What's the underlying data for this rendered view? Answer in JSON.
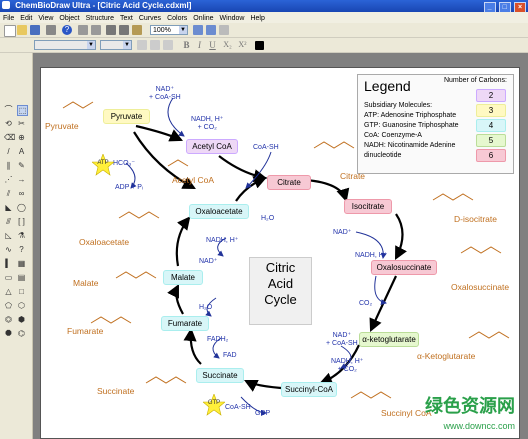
{
  "window": {
    "title": "ChemBioDraw Ultra - [Citric Acid Cycle.cdxml]",
    "controls": [
      "_",
      "□",
      "×"
    ]
  },
  "menu": [
    "File",
    "Edit",
    "View",
    "Object",
    "Structure",
    "Text",
    "Curves",
    "Colors",
    "Online",
    "Window",
    "Help"
  ],
  "toolbar": {
    "zoom": "100%",
    "format_buttons": [
      "B",
      "I",
      "U",
      "X₂",
      "X²"
    ]
  },
  "legend": {
    "title": "Legend",
    "carbons_label": "Number of Carbons:",
    "subsidiary_title": "Subsidiary Molecules:",
    "entries": [
      "ATP: Adenosine Triphosphate",
      "GTP: Guanosine Triphosphate",
      "CoA: Coenzyme-A",
      "NADH: Nicotinamide Adenine",
      "dinucleotide"
    ],
    "carbons": [
      "2",
      "3",
      "4",
      "5",
      "6"
    ]
  },
  "center": {
    "line1": "Citric",
    "line2": "Acid",
    "line3": "Cycle"
  },
  "boxes": {
    "pyruvate": "Pyruvate",
    "acetyl_coa": "Acetyl CoA",
    "citrate": "Citrate",
    "isocitrate": "Isocitrate",
    "oxalosuccinate": "Oxalosuccinate",
    "ketoglutarate": "α-ketoglutarate",
    "succinyl_coa": "Succinyl-CoA",
    "succinate": "Succinate",
    "fumarate": "Fumarate",
    "malate": "Malate",
    "oxaloacetate": "Oxaloacetate"
  },
  "molecule_names": {
    "pyruvate": "Pyruvate",
    "acetyl_coa": "Acetyl CoA",
    "citrate": "Citrate",
    "d_isocitrate": "D-isocitrate",
    "oxalosuccinate": "Oxalosuccinate",
    "ketoglutarate": "α-Ketoglutarate",
    "succinyl_coa": "Succinyl CoA",
    "succinate": "Succinate",
    "fumarate": "Fumarate",
    "malate": "Malate",
    "oxaloacetate": "Oxaloacetate"
  },
  "cofactors": {
    "nad_coash_top": "NAD⁺\n+ CoA-SH",
    "nadh_co2_top": "NADH, H⁺\n+ CO₂",
    "hco3": "HCO₃⁻",
    "adp": "ADP + Pᵢ",
    "coash_citrate": "CoA-SH",
    "h2o_citrate": "H₂O",
    "nad_iso": "NAD⁺",
    "nadh_iso": "NADH, H⁺",
    "co2_oxalo": "CO₂",
    "nad_coash_akg": "NAD⁺\n+ CoA-SH",
    "nadh_co2_akg": "NADH, H⁺\n+ CO₂",
    "coash_succ": "CoA-SH",
    "gdp": "GDP",
    "fadh2": "FADH₂",
    "fad": "FAD",
    "h2o_fum": "H₂O",
    "nad_mal": "NAD⁺",
    "nadh_mal": "NADH, H⁺",
    "atp": "ATP",
    "gtp": "GTP"
  },
  "watermark": {
    "main": "绿色资源网",
    "sub": "www.downcc.com"
  },
  "colors": {
    "accent": "#2b63d6",
    "molecule": "#c07020",
    "cofactor": "#2233aa",
    "red_atom": "#cc2222"
  }
}
